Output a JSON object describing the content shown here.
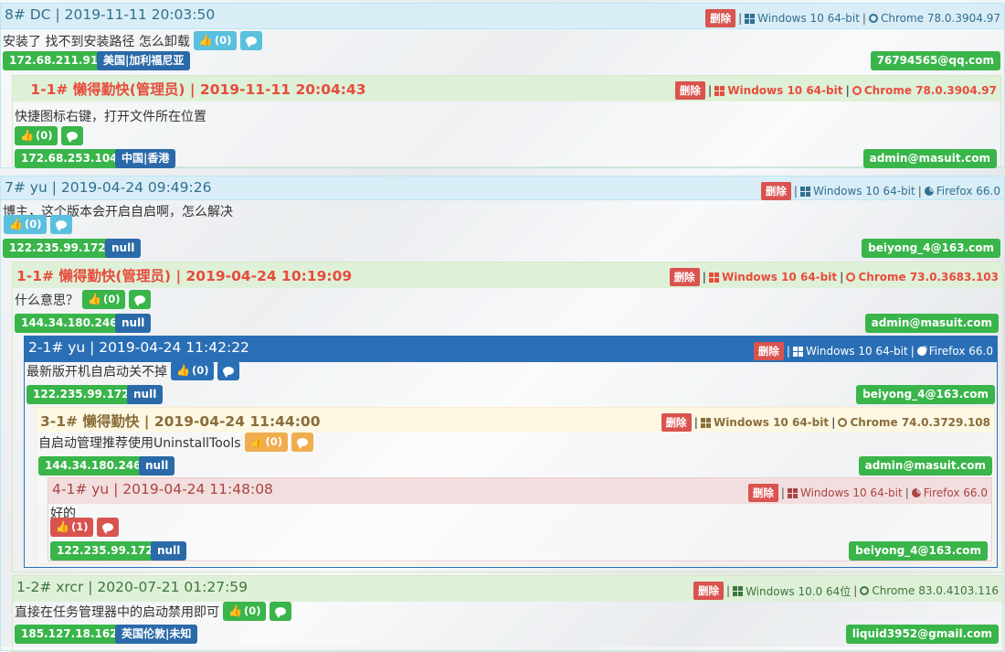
{
  "comments": {
    "c8": {
      "title": "8# DC | 2019-11-11 20:03:50",
      "delete_label": "删除",
      "os": "Windows 10 64-bit",
      "browser": "Chrome 78.0.3904.97",
      "content": "安装了 找不到安装路径 怎么卸载",
      "like_label": "(0)",
      "ip": "172.68.211.91",
      "location": "美国|加利福尼亚",
      "email": "76794565@qq.com"
    },
    "c8r1": {
      "title": "1-1# 懒得勤快(管理员) | 2019-11-11 20:04:43",
      "delete_label": "删除",
      "os": "Windows 10 64-bit",
      "browser": "Chrome 78.0.3904.97",
      "content": "快捷图标右键，打开文件所在位置",
      "like_label": "(0)",
      "ip": "172.68.253.104",
      "location": "中国|香港",
      "email": "admin@masuit.com"
    },
    "c7": {
      "title": "7# yu | 2019-04-24 09:49:26",
      "delete_label": "删除",
      "os": "Windows 10 64-bit",
      "browser": "Firefox 66.0",
      "content": "博主，这个版本会开启自启啊，怎么解决",
      "like_label": "(0)",
      "ip": "122.235.99.172",
      "location": "null",
      "email": "beiyong_4@163.com"
    },
    "c7r1": {
      "title": "1-1# 懒得勤快(管理员) | 2019-04-24 10:19:09",
      "delete_label": "删除",
      "os": "Windows 10 64-bit",
      "browser": "Chrome 73.0.3683.103",
      "content": "什么意思？",
      "like_label": "(0)",
      "ip": "144.34.180.246",
      "location": "null",
      "email": "admin@masuit.com"
    },
    "c7r2": {
      "title": "2-1# yu | 2019-04-24 11:42:22",
      "delete_label": "删除",
      "os": "Windows 10 64-bit",
      "browser": "Firefox 66.0",
      "content": "最新版开机自启动关不掉",
      "like_label": "(0)",
      "ip": "122.235.99.172",
      "location": "null",
      "email": "beiyong_4@163.com"
    },
    "c7r3": {
      "title": "3-1# 懒得勤快 | 2019-04-24 11:44:00",
      "delete_label": "删除",
      "os": "Windows 10 64-bit",
      "browser": "Chrome 74.0.3729.108",
      "content": "自启动管理推荐使用UninstallTools",
      "like_label": "(0)",
      "ip": "144.34.180.246",
      "location": "null",
      "email": "admin@masuit.com"
    },
    "c7r4": {
      "title": "4-1# yu | 2019-04-24 11:48:08",
      "delete_label": "删除",
      "os": "Windows 10 64-bit",
      "browser": "Firefox 66.0",
      "content": "好的",
      "like_label": "(1)",
      "ip": "122.235.99.172",
      "location": "null",
      "email": "beiyong_4@163.com"
    },
    "c7r5": {
      "title": "1-2# xrcr | 2020-07-21 01:27:59",
      "delete_label": "删除",
      "os": "Windows 10.0 64位",
      "browser": "Chrome 83.0.4103.116",
      "content": "直接在任务管理器中的启动禁用即可",
      "like_label": "(0)",
      "ip": "185.127.18.162",
      "location": "英国伦敦|未知",
      "email": "liquid3952@gmail.com"
    }
  },
  "icons": {
    "admin": "user-icon",
    "like": "thumbs-up-icon",
    "reply": "comment-icon",
    "os": "windows-icon",
    "chrome": "chrome-icon",
    "firefox": "firefox-icon"
  },
  "colors": {
    "info_bg": "#d9edf7",
    "info_text": "#31708f",
    "success_bg": "#dff0d8",
    "admin_text": "#e74c3c",
    "primary_bg": "#2a6fb5",
    "warning_bg": "#fcf8e3",
    "warning_text": "#8a6d3b",
    "danger_bg": "#f2dede",
    "danger_text": "#a94442",
    "green_tag": "#39b54a",
    "blue_tag": "#2b6aa8"
  }
}
